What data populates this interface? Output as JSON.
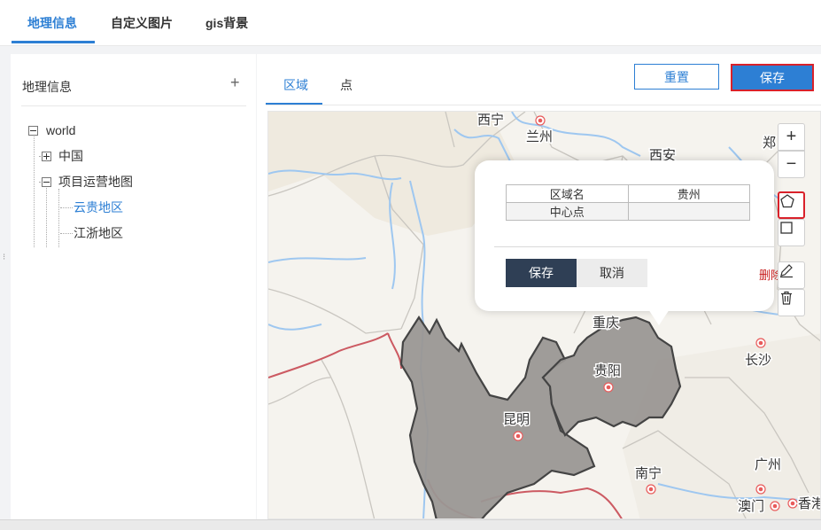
{
  "top_tabs": [
    {
      "label": "地理信息",
      "active": true
    },
    {
      "label": "自定义图片",
      "active": false
    },
    {
      "label": "gis背景",
      "active": false
    }
  ],
  "left_panel": {
    "title": "地理信息",
    "add_symbol": "+",
    "tree": {
      "root": "world",
      "china": "中国",
      "project": "项目运营地图",
      "yungui": "云贵地区",
      "jiangzhe": "江浙地区",
      "selected": "云贵地区"
    }
  },
  "right_panel": {
    "sub_tabs": [
      {
        "label": "区域",
        "active": true
      },
      {
        "label": "点",
        "active": false
      }
    ],
    "reset_label": "重置",
    "save_label": "保存"
  },
  "map": {
    "controls": {
      "zoom_in": "+",
      "zoom_out": "−"
    },
    "labels": [
      "西宁",
      "兰州",
      "西安",
      "郑",
      "重庆",
      "贵阳",
      "长沙",
      "昆明",
      "南宁",
      "广州",
      "澳门",
      "香港"
    ],
    "colors": {
      "region_fill": "#9a9794",
      "region_stroke": "#444444",
      "border_red": "#cc5a62",
      "river": "#9ec7f0"
    }
  },
  "popup": {
    "field_name_label": "区域名",
    "field_name_value": "贵州",
    "center_label": "中心点",
    "center_value": "",
    "save_label": "保存",
    "cancel_label": "取消",
    "delete_label": "删除"
  }
}
